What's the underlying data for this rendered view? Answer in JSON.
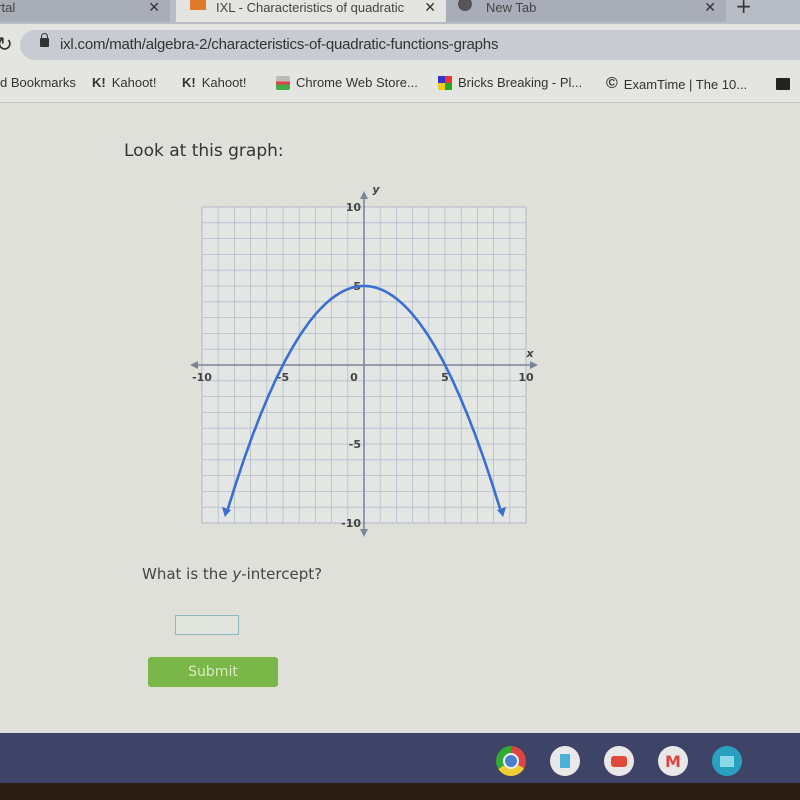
{
  "browser": {
    "tabs": [
      {
        "title": "ortal",
        "active": false
      },
      {
        "title": "IXL - Characteristics of quadratic",
        "active": true
      },
      {
        "title": "New Tab",
        "active": false
      }
    ],
    "url": "ixl.com/math/algebra-2/characteristics-of-quadratic-functions-graphs",
    "bookmarks": [
      {
        "label": "d Bookmarks",
        "icon": "folder-icon"
      },
      {
        "label": "Kahoot!",
        "icon": "K!"
      },
      {
        "label": "Kahoot!",
        "icon": "K!"
      },
      {
        "label": "Chrome Web Store...",
        "icon": "chrome-web-store-icon"
      },
      {
        "label": "Bricks Breaking - Pl...",
        "icon": "bricks-icon"
      },
      {
        "label": "ExamTime | The 10...",
        "icon": "examtime-icon"
      }
    ]
  },
  "page": {
    "prompt": "Look at this graph:",
    "question_pre": "What is the ",
    "question_var": "y",
    "question_post": "-intercept?",
    "answer_value": "",
    "submit_label": "Submit"
  },
  "chart_data": {
    "type": "line",
    "title": "",
    "xlabel": "x",
    "ylabel": "y",
    "xlim": [
      -10,
      10
    ],
    "ylim": [
      -10,
      10
    ],
    "grid": true,
    "x_tick_labels": [
      "-10",
      "-5",
      "0",
      "5",
      "10"
    ],
    "y_tick_labels": [
      "10",
      "5",
      "-5",
      "-10"
    ],
    "series": [
      {
        "name": "parabola",
        "equation": "y = -0.2x^2 + 5",
        "x": [
          -8.4,
          -8,
          -7,
          -6,
          -5,
          -4,
          -3,
          -2,
          -1,
          0,
          1,
          2,
          3,
          4,
          5,
          6,
          7,
          8,
          8.4
        ],
        "y": [
          -9.1,
          -7.8,
          -4.8,
          -2.2,
          0,
          1.8,
          3.2,
          4.2,
          4.8,
          5,
          4.8,
          4.2,
          3.2,
          1.8,
          0,
          -2.2,
          -4.8,
          -7.8,
          -9.1
        ],
        "color": "#3a6fd0"
      }
    ]
  },
  "shelf": {
    "apps": [
      "chrome-icon",
      "docs-icon",
      "youtube-icon",
      "gmail-icon",
      "files-icon"
    ]
  }
}
